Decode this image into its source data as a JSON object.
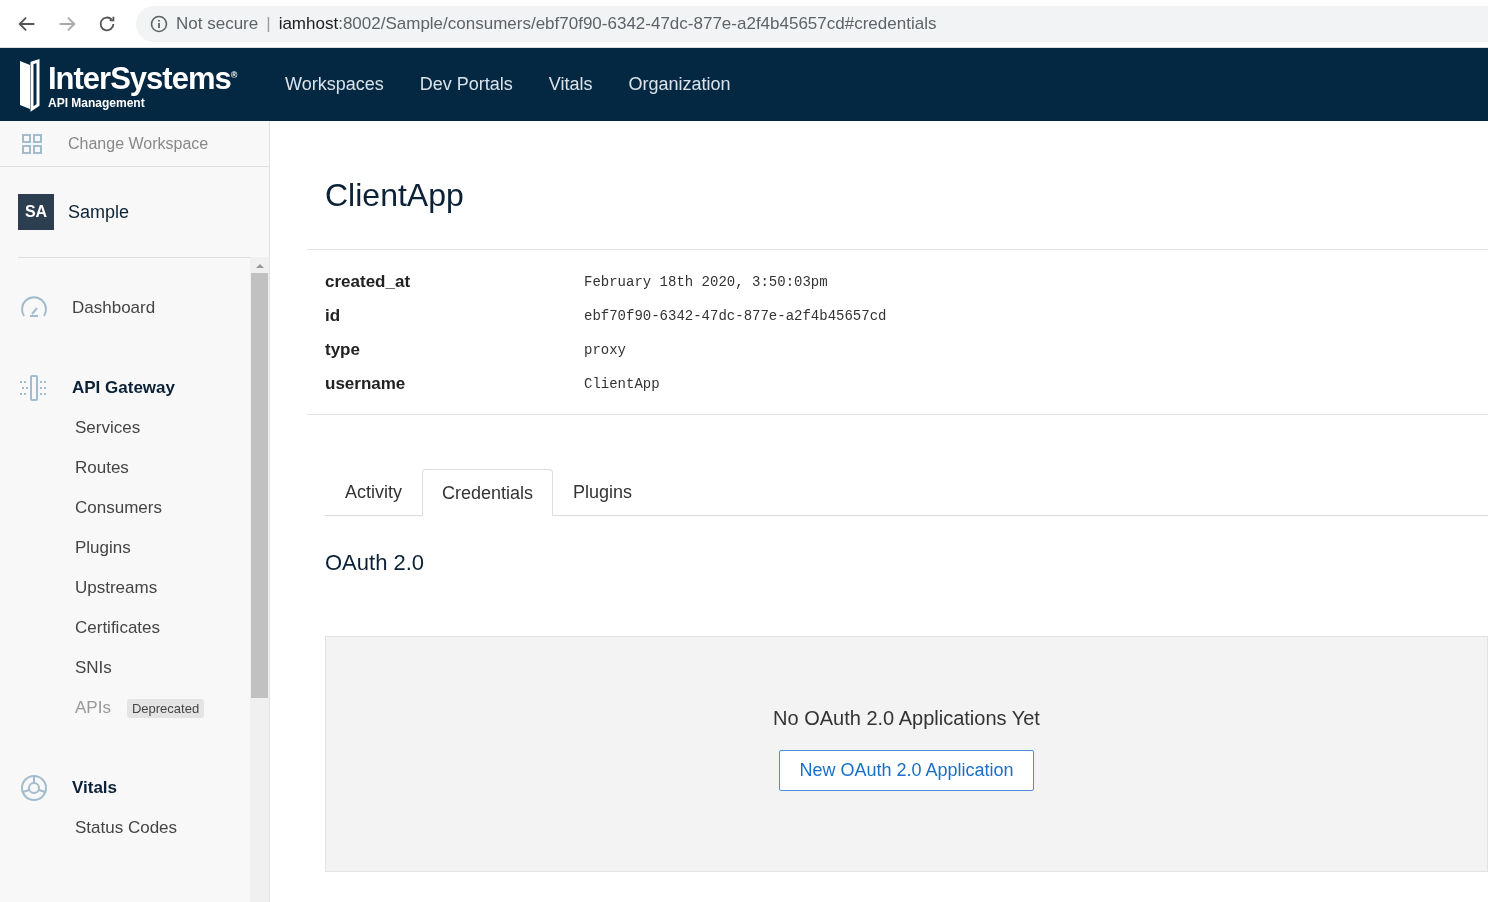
{
  "browser": {
    "security": "Not secure",
    "separator": "|",
    "url_host": "iamhost",
    "url_path": ":8002/Sample/consumers/ebf70f90-6342-47dc-877e-a2f4b45657cd#credentials"
  },
  "header": {
    "logo": "InterSystems",
    "logo_mark": "®",
    "logo_sub": "API Management",
    "nav": [
      "Workspaces",
      "Dev Portals",
      "Vitals",
      "Organization"
    ]
  },
  "sidebar": {
    "change_workspace": "Change Workspace",
    "workspace": {
      "initials": "SA",
      "name": "Sample"
    },
    "sections": [
      {
        "kind": "dashboard",
        "title": "Dashboard",
        "bold": false
      },
      {
        "kind": "gateway",
        "title": "API Gateway",
        "bold": true,
        "children": [
          {
            "label": "Services",
            "disabled": false
          },
          {
            "label": "Routes",
            "disabled": false
          },
          {
            "label": "Consumers",
            "disabled": false
          },
          {
            "label": "Plugins",
            "disabled": false
          },
          {
            "label": "Upstreams",
            "disabled": false
          },
          {
            "label": "Certificates",
            "disabled": false
          },
          {
            "label": "SNIs",
            "disabled": false
          },
          {
            "label": "APIs",
            "disabled": true,
            "badge": "Deprecated"
          }
        ]
      },
      {
        "kind": "vitals",
        "title": "Vitals",
        "bold": true,
        "children": [
          {
            "label": "Status Codes",
            "disabled": false
          }
        ]
      }
    ]
  },
  "main": {
    "title": "ClientApp",
    "fields": [
      {
        "key": "created_at",
        "value": "February 18th 2020, 3:50:03pm"
      },
      {
        "key": "id",
        "value": "ebf70f90-6342-47dc-877e-a2f4b45657cd"
      },
      {
        "key": "type",
        "value": "proxy"
      },
      {
        "key": "username",
        "value": "ClientApp"
      }
    ],
    "tabs": [
      {
        "label": "Activity",
        "selected": false
      },
      {
        "label": "Credentials",
        "selected": true
      },
      {
        "label": "Plugins",
        "selected": false
      }
    ],
    "section_title": "OAuth 2.0",
    "empty": {
      "message": "No OAuth 2.0 Applications Yet",
      "button": "New OAuth 2.0 Application"
    }
  }
}
